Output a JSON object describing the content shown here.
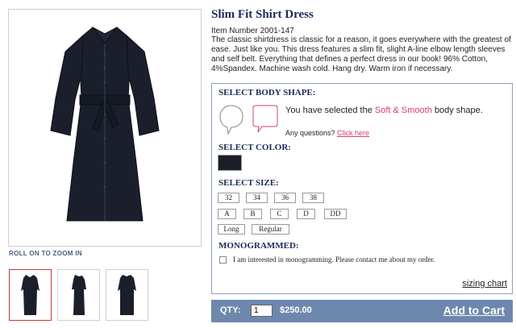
{
  "product": {
    "title": "Slim Fit Shirt Dress",
    "item_number": "Item Number 2001-147",
    "description": "The classic shirtdress is classic for a reason, it goes everywhere with the greatest of ease. Just like you. This dress features a slim fit, slight A-line elbow length sleeves and self belt. Everything that defines a perfect dress in our book! 96% Cotton, 4%Spandex. Machine wash cold. Hang dry. Warm iron if necessary."
  },
  "image": {
    "zoom_label": "ROLL ON TO ZOOM IN"
  },
  "options": {
    "body_shape_title": "SELECT BODY SHAPE:",
    "shape_msg_prefix": "You have selected the ",
    "shape_selected": "Soft & Smooth",
    "shape_msg_suffix": " body shape.",
    "questions_text": "Any questions? ",
    "click_here": "Click here",
    "color_title": "SELECT COLOR:",
    "color_swatch": "#1c1f27",
    "size_title": "SELECT SIZE:",
    "sizes": [
      "32",
      "34",
      "36",
      "38"
    ],
    "cups": [
      "A",
      "B",
      "C",
      "D",
      "DD"
    ],
    "lengths": [
      "Long",
      "Regular"
    ],
    "monogram_title": "MONOGRAMMED:",
    "monogram_label": "I am interested in monogramming. Please contact me about my order.",
    "sizing_chart": "sizing chart"
  },
  "cart": {
    "qty_label": "QTY:",
    "qty_value": "1",
    "price": "$250.00",
    "add_to_cart": "Add to Cart"
  },
  "colors": {
    "accent_pink": "#d43f6e",
    "title_navy": "#1a2b5a",
    "cart_bar": "#6e88ad"
  }
}
